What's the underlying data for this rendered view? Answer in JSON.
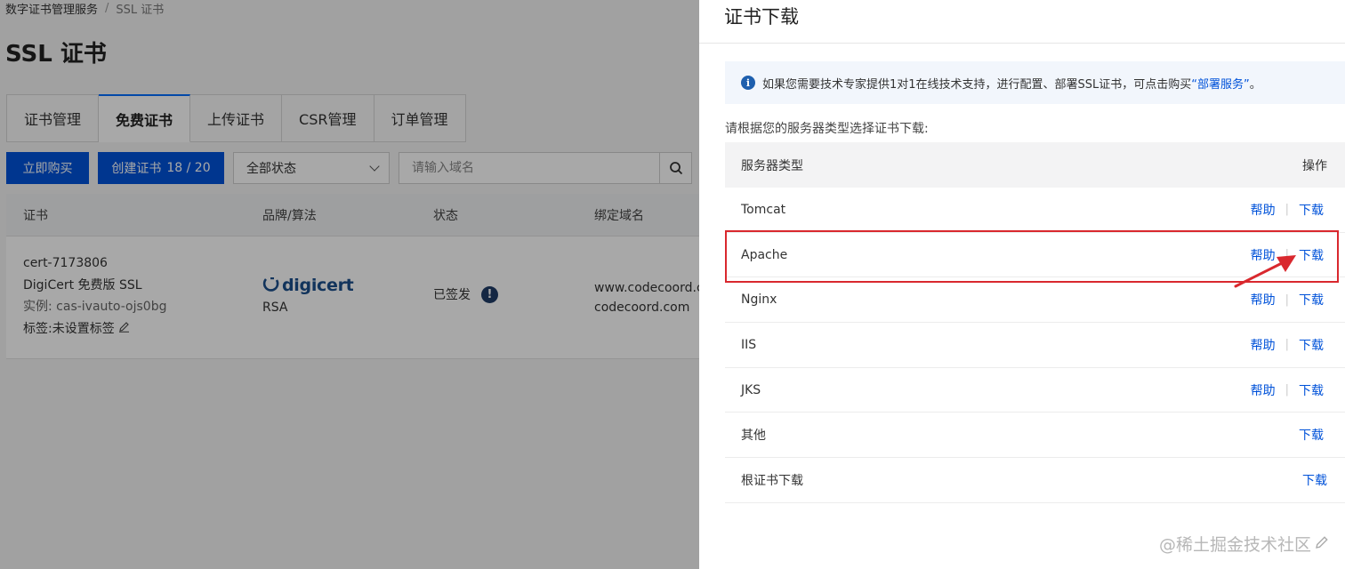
{
  "breadcrumb": {
    "root": "数字证书管理服务",
    "separator": "/",
    "current": "SSL 证书"
  },
  "page_title": "SSL 证书",
  "tabs": [
    {
      "label": "证书管理",
      "active": false
    },
    {
      "label": "免费证书",
      "active": true
    },
    {
      "label": "上传证书",
      "active": false
    },
    {
      "label": "CSR管理",
      "active": false
    },
    {
      "label": "订单管理",
      "active": false
    }
  ],
  "toolbar": {
    "buy_label": "立即购买",
    "create_label": "创建证书",
    "create_count": "18 / 20",
    "status_select": "全部状态",
    "search_placeholder": "请输入域名"
  },
  "cert_table": {
    "headers": {
      "cert": "证书",
      "brand": "品牌/算法",
      "status": "状态",
      "domain": "绑定域名"
    },
    "row": {
      "cert_id": "cert-7173806",
      "cert_name": "DigiCert 免费版 SSL",
      "instance": "实例: cas-ivauto-ojs0bg",
      "tags": "标签:未设置标签",
      "brand_logo": "digicert",
      "algorithm": "RSA",
      "status": "已签发",
      "domains": [
        "www.codecoord.com",
        "codecoord.com"
      ]
    }
  },
  "drawer": {
    "title": "证书下载",
    "notice_text": "如果您需要技术专家提供1对1在线技术支持，进行配置、部署SSL证书，可点击购买",
    "notice_link": "“部署服务”",
    "notice_end": "。",
    "instruction": "请根据您的服务器类型选择证书下载:",
    "table_header": {
      "server_type": "服务器类型",
      "action": "操作"
    },
    "help_label": "帮助",
    "download_label": "下载",
    "rows": [
      {
        "name": "Tomcat",
        "has_help": true
      },
      {
        "name": "Apache",
        "has_help": true,
        "highlighted": true
      },
      {
        "name": "Nginx",
        "has_help": true
      },
      {
        "name": "IIS",
        "has_help": true
      },
      {
        "name": "JKS",
        "has_help": true
      },
      {
        "name": "其他",
        "has_help": false
      },
      {
        "name": "根证书下载",
        "has_help": false
      }
    ]
  },
  "colors": {
    "primary": "#0052d9",
    "highlight": "#d9282e",
    "overlay": "rgba(0,0,0,0.34)"
  },
  "watermark": "@稀土掘金技术社区"
}
